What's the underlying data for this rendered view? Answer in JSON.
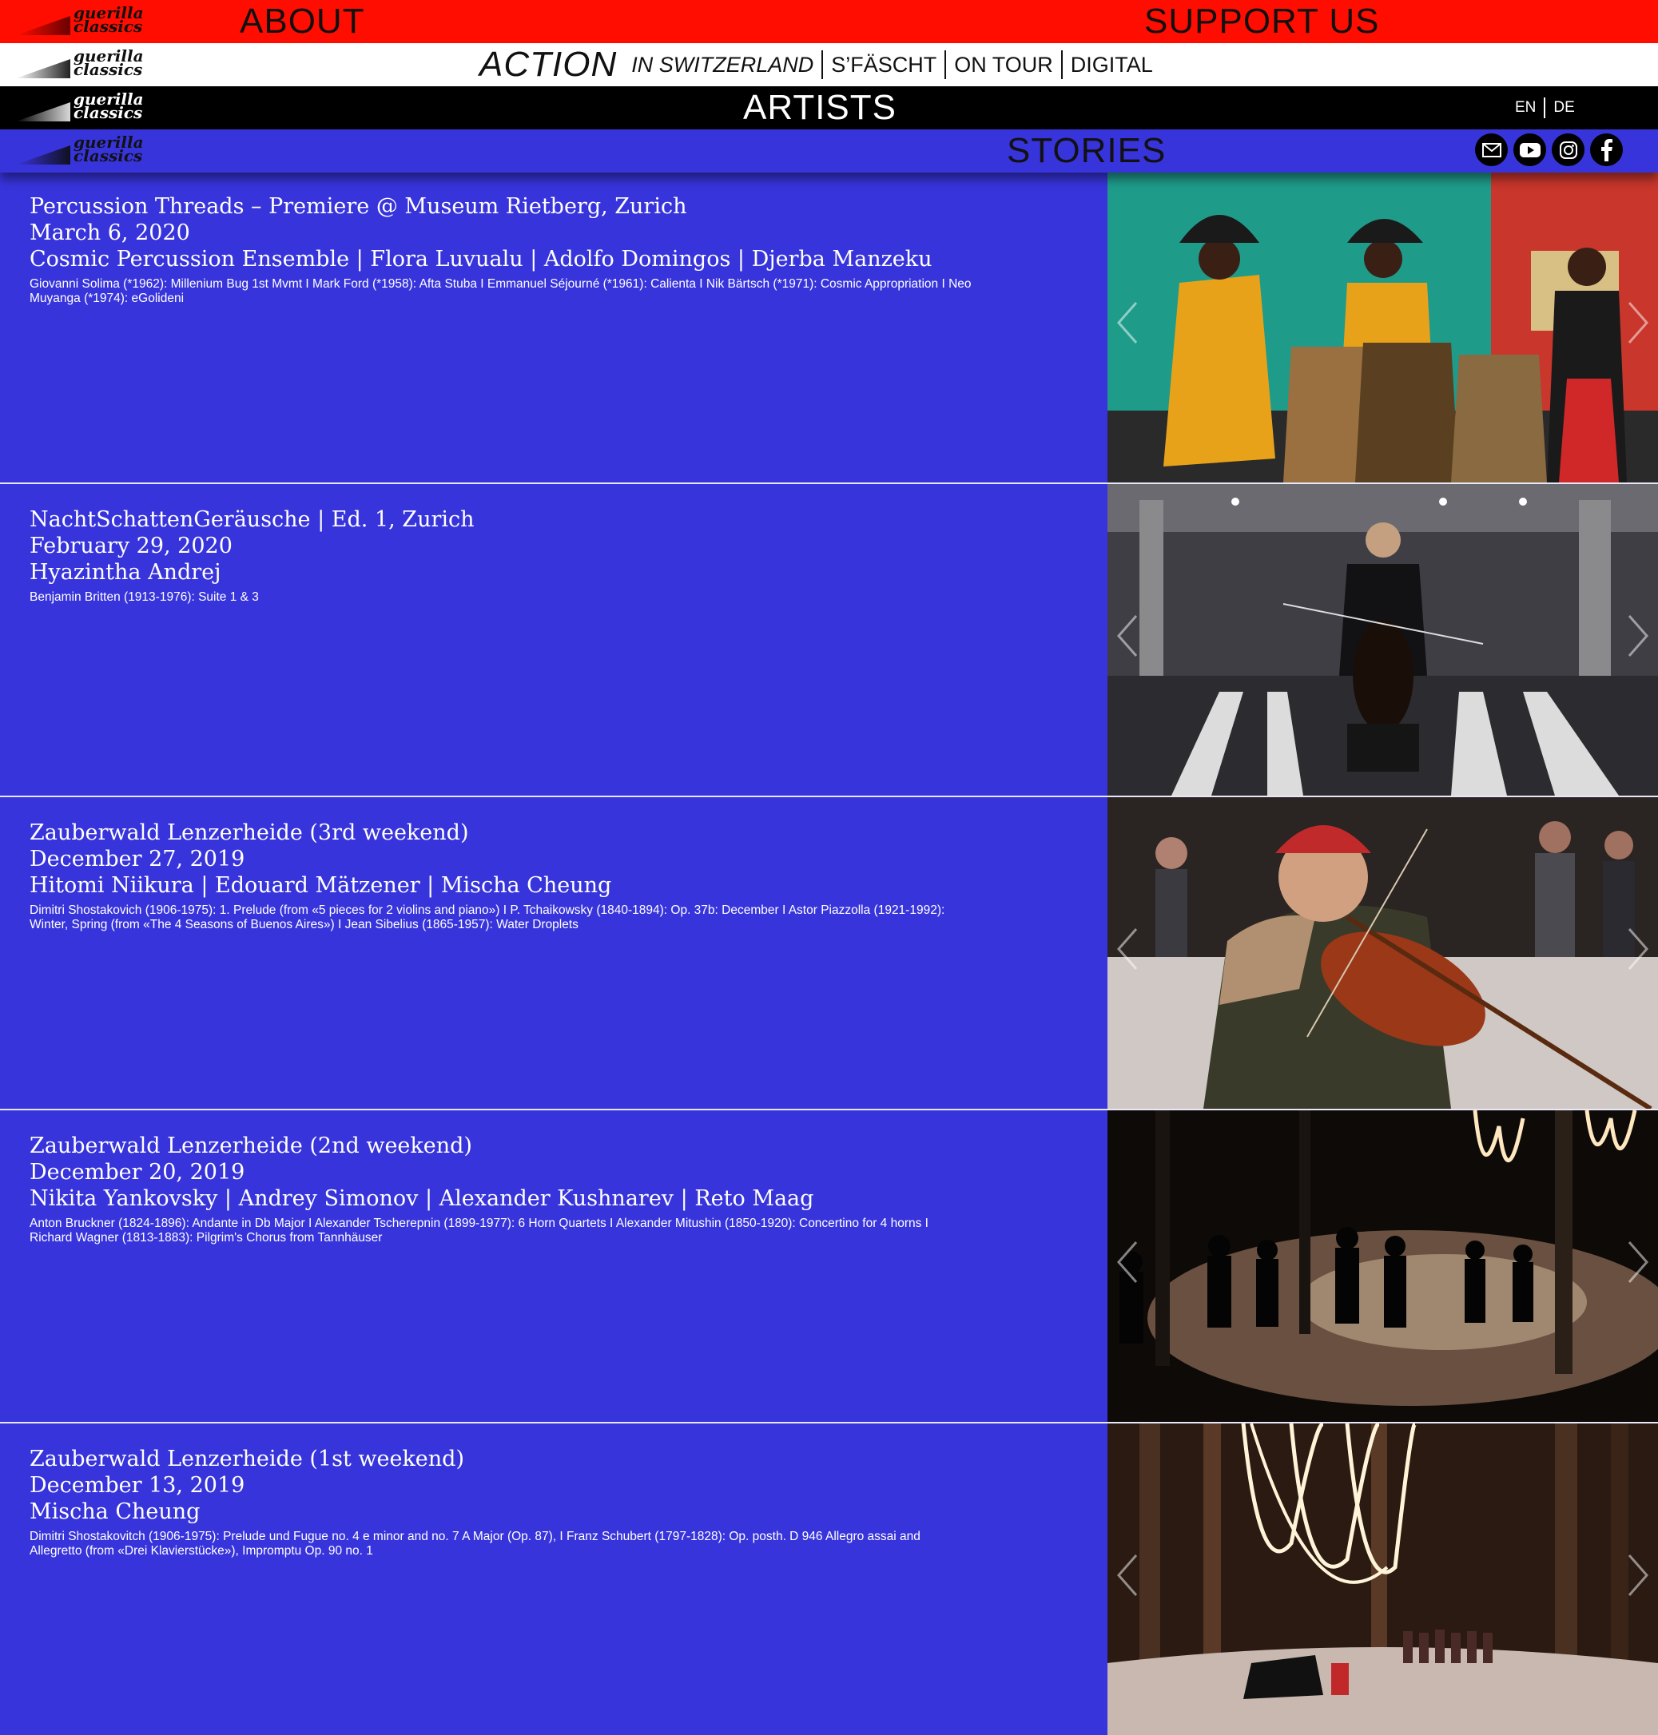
{
  "logo": {
    "line1": "guerilla",
    "line2": "classics"
  },
  "nav": {
    "about": "ABOUT",
    "support": "SUPPORT US",
    "action": "ACTION",
    "action_items": [
      "IN SWITZERLAND",
      "S’FÄSCHT",
      "ON TOUR",
      "DIGITAL"
    ],
    "artists": "ARTISTS",
    "stories": "STORIES"
  },
  "lang": {
    "en": "EN",
    "de": "DE"
  },
  "social": [
    "mail-icon",
    "youtube-icon",
    "instagram-icon",
    "facebook-icon"
  ],
  "colors": {
    "red": "#ff0d00",
    "blue": "#3834dc",
    "black": "#000000",
    "white": "#ffffff"
  },
  "stories": [
    {
      "title": "Percussion Threads – Premiere @ Museum Rietberg, Zurich",
      "date": "March 6, 2020",
      "artists": "Cosmic Percussion Ensemble | Flora Luvualu | Adolfo Domingos | Djerba Manzeku",
      "program": "Giovanni Solima (*1962): Millenium Bug 1st Mvmt I Mark Ford (*1958): Afta Stuba I Emmanuel Séjourné (*1961): Calienta I Nik Bärtsch (*1971): Cosmic Appropriation I Neo Muyanga (*1974): eGolideni"
    },
    {
      "title": "NachtSchattenGeräusche | Ed. 1, Zurich",
      "date": "February 29, 2020",
      "artists": "Hyazintha Andrej",
      "program": "Benjamin Britten (1913-1976): Suite 1 & 3"
    },
    {
      "title": "Zauberwald Lenzerheide (3rd weekend)",
      "date": "December 27, 2019",
      "artists": "Hitomi Niikura | Edouard Mätzener | Mischa Cheung",
      "program": "Dimitri Shostakovich (1906-1975): 1. Prelude (from «5 pieces for 2 violins and piano») I P. Tchaikowsky (1840-1894): Op. 37b: December I Astor Piazzolla (1921-1992): Winter, Spring (from «The 4 Seasons of Buenos Aires») I Jean Sibelius (1865-1957): Water Droplets"
    },
    {
      "title": "Zauberwald Lenzerheide (2nd weekend)",
      "date": "December 20, 2019",
      "artists": "Nikita Yankovsky | Andrey Simonov | Alexander Kushnarev | Reto Maag",
      "program": "Anton Bruckner (1824-1896): Andante in Db Major I Alexander Tscherepnin (1899-1977): 6 Horn Quartets I Alexander Mitushin (1850-1920): Concertino for 4 horns I Richard Wagner (1813-1883): Pilgrim's Chorus from Tannhäuser"
    },
    {
      "title": "Zauberwald Lenzerheide (1st weekend)",
      "date": "December 13, 2019",
      "artists": "Mischa Cheung",
      "program": "Dimitri Shostakovitch (1906-1975): Prelude und Fugue no. 4 e minor and no. 7 A Major (Op. 87),  I Franz Schubert (1797-1828): Op. posth. D 946 Allegro assai and Allegretto (from «Drei Klavierstücke»), Impromptu Op. 90 no. 1"
    }
  ]
}
